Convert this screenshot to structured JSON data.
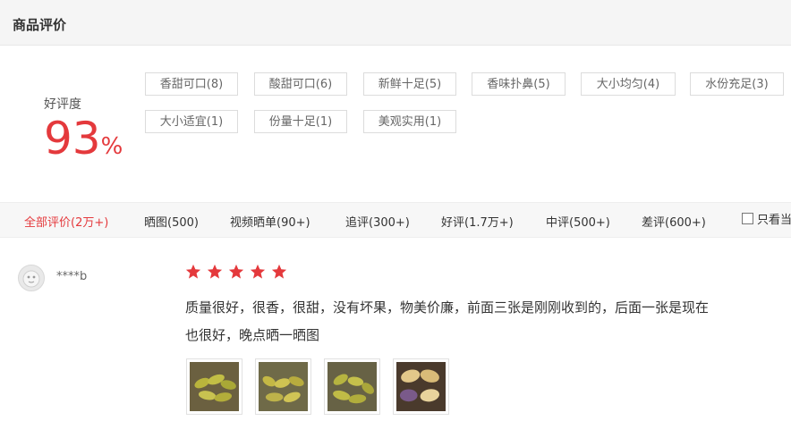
{
  "header": {
    "title": "商品评价"
  },
  "rating": {
    "label": "好评度",
    "value": "93",
    "unit": "%"
  },
  "tags": [
    "香甜可口(8)",
    "酸甜可口(6)",
    "新鲜十足(5)",
    "香味扑鼻(5)",
    "大小均匀(4)",
    "水份充足(3)",
    "大小适宜(1)",
    "份量十足(1)",
    "美观实用(1)"
  ],
  "filters": [
    "全部评价(2万+)",
    "晒图(500)",
    "视频晒单(90+)",
    "追评(300+)",
    "好评(1.7万+)",
    "中评(500+)",
    "差评(600+)"
  ],
  "only_view_label": "只看当",
  "review": {
    "user": "****b",
    "stars": 5,
    "text_line1": "质量很好，很香，很甜，没有坏果，物美价廉，前面三张是刚刚收到的，后面一张是现在",
    "text_line2": "也很好，晚点晒一晒图",
    "images": [
      "mango-photo",
      "mango-photo",
      "mango-photo",
      "mango-cut-photo"
    ]
  },
  "colors": {
    "accent": "#e4393c",
    "star": "#e4393c"
  },
  "icons": [
    "checkbox-icon",
    "star-icon",
    "avatar-icon"
  ]
}
